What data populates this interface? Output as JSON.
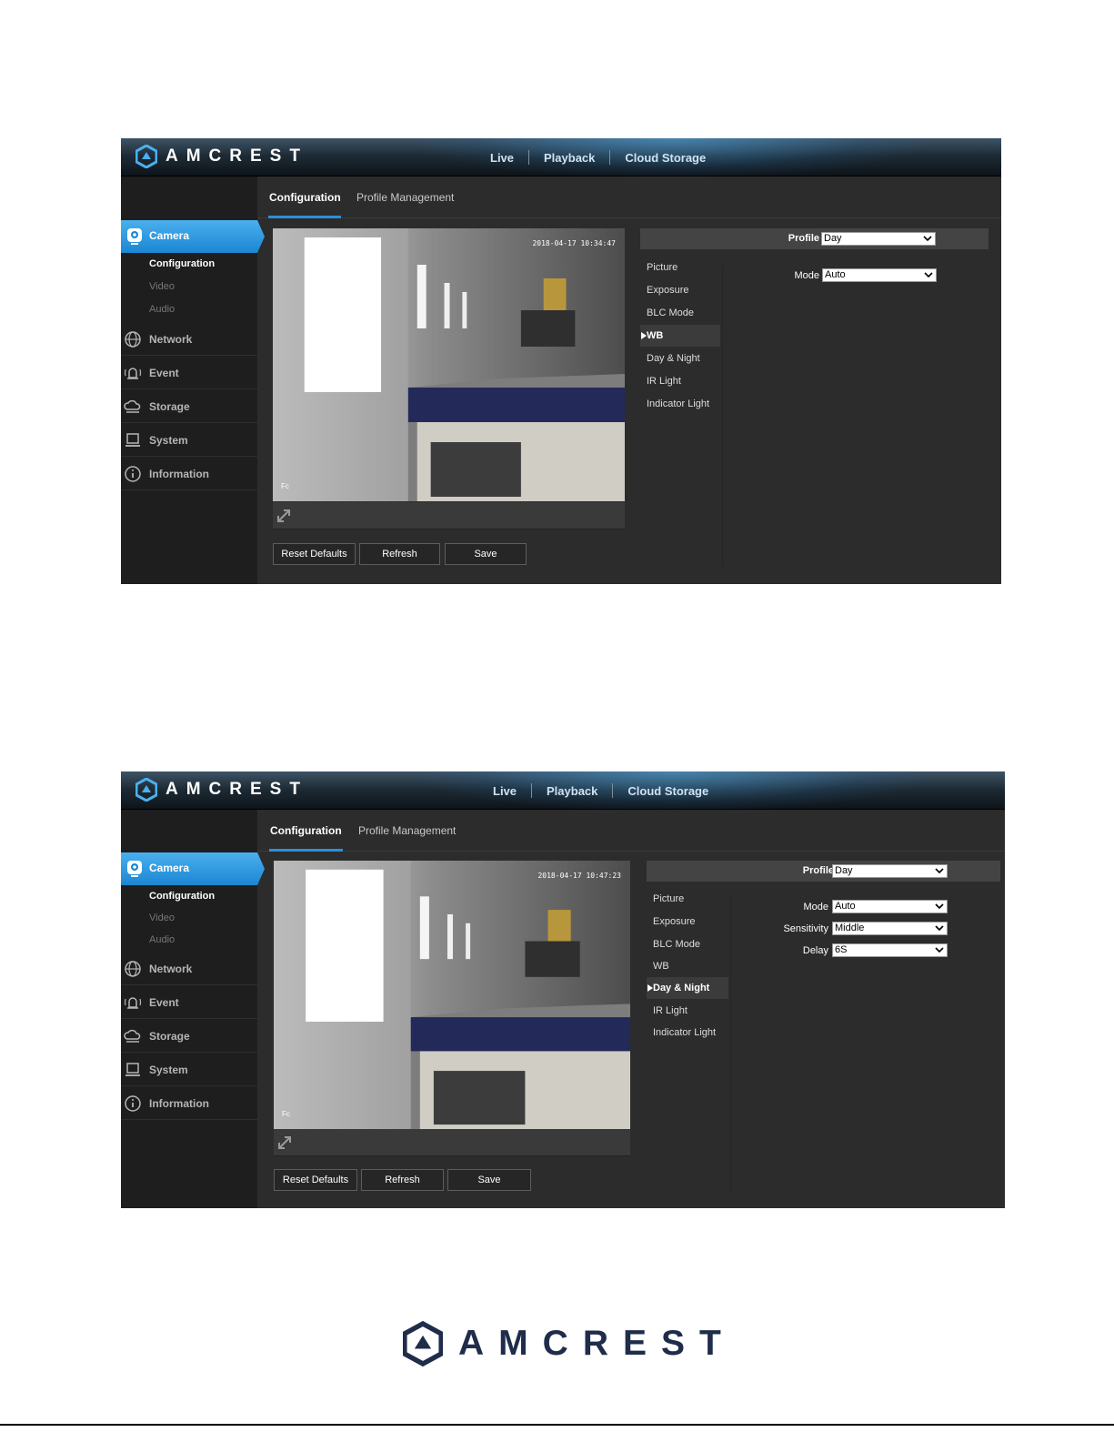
{
  "brand": {
    "name": "AMCREST",
    "logo_icon": "hexagon-logo-icon"
  },
  "screenshots": [
    {
      "topnav": [
        "Live",
        "Playback",
        "Cloud Storage"
      ],
      "sidebar": {
        "camera": "Camera",
        "camera_subitems": [
          "Configuration",
          "Video",
          "Audio"
        ],
        "items": [
          {
            "label": "Network",
            "icon": "network-globe-icon"
          },
          {
            "label": "Event",
            "icon": "event-alarm-icon"
          },
          {
            "label": "Storage",
            "icon": "storage-cloud-icon"
          },
          {
            "label": "System",
            "icon": "system-monitor-icon"
          },
          {
            "label": "Information",
            "icon": "information-icon"
          }
        ]
      },
      "tabs": [
        "Configuration",
        "Profile Management"
      ],
      "video": {
        "timestamp": "2018-04-17 10:34:47",
        "channel": "Fc"
      },
      "buttons": [
        "Reset Defaults",
        "Refresh",
        "Save"
      ],
      "profile": {
        "label": "Profile",
        "value": "Day"
      },
      "submenu": [
        "Picture",
        "Exposure",
        "BLC Mode",
        "WB",
        "Day & Night",
        "IR Light",
        "Indicator Light"
      ],
      "active_submenu": "WB",
      "fields": [
        {
          "label": "Mode",
          "value": "Auto"
        }
      ]
    },
    {
      "topnav": [
        "Live",
        "Playback",
        "Cloud Storage"
      ],
      "sidebar": {
        "camera": "Camera",
        "camera_subitems": [
          "Configuration",
          "Video",
          "Audio"
        ],
        "items": [
          {
            "label": "Network",
            "icon": "network-globe-icon"
          },
          {
            "label": "Event",
            "icon": "event-alarm-icon"
          },
          {
            "label": "Storage",
            "icon": "storage-cloud-icon"
          },
          {
            "label": "System",
            "icon": "system-monitor-icon"
          },
          {
            "label": "Information",
            "icon": "information-icon"
          }
        ]
      },
      "tabs": [
        "Configuration",
        "Profile Management"
      ],
      "video": {
        "timestamp": "2018-04-17 10:47:23",
        "channel": "Fc"
      },
      "buttons": [
        "Reset Defaults",
        "Refresh",
        "Save"
      ],
      "profile": {
        "label": "Profile",
        "value": "Day"
      },
      "submenu": [
        "Picture",
        "Exposure",
        "BLC Mode",
        "WB",
        "Day & Night",
        "IR Light",
        "Indicator Light"
      ],
      "active_submenu": "Day & Night",
      "fields": [
        {
          "label": "Mode",
          "value": "Auto"
        },
        {
          "label": "Sensitivity",
          "value": "Middle"
        },
        {
          "label": "Delay",
          "value": "6S"
        }
      ]
    }
  ],
  "colors": {
    "accent": "#2b90d9",
    "brand_navy": "#1f2d4b",
    "panel": "#2c2c2c",
    "sidebar": "#1e1e1e"
  }
}
